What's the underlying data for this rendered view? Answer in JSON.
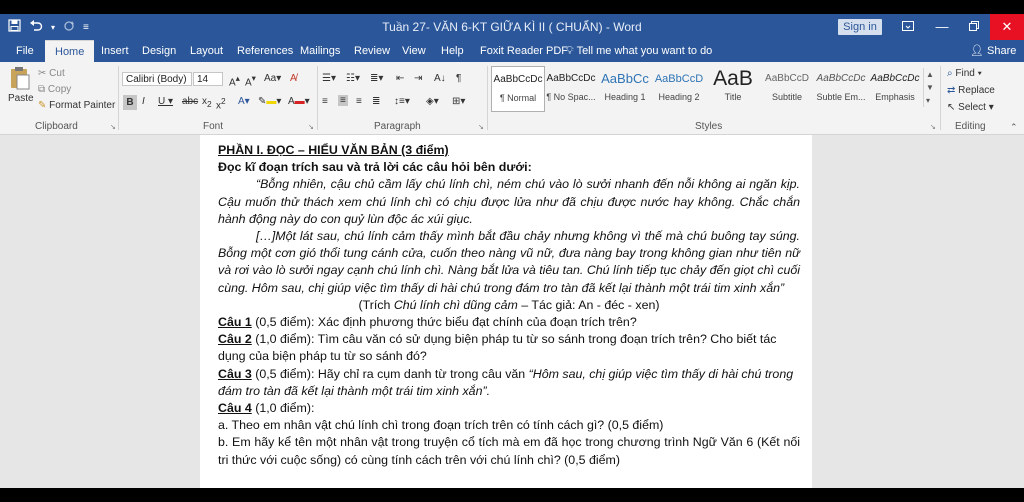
{
  "window": {
    "title": "Tuần 27- VĂN 6-KT GIỮA KÌ II ( CHUẨN) - Word",
    "sign_in": "Sign in",
    "icons": [
      "save-icon",
      "undo-icon",
      "redo-icon",
      "customize-qat-icon",
      "ribbon-display-icon",
      "minimize-icon",
      "restore-icon",
      "close-icon"
    ]
  },
  "tabs": [
    "File",
    "Home",
    "Insert",
    "Design",
    "Layout",
    "References",
    "Mailings",
    "Review",
    "View",
    "Help",
    "Foxit Reader PDF"
  ],
  "active_tab": "Home",
  "tell_me": "Tell me what you want to do",
  "share": "Share",
  "ribbon": {
    "clipboard": {
      "paste": "Paste",
      "cut": "Cut",
      "copy": "Copy",
      "format_painter": "Format Painter",
      "label": "Clipboard"
    },
    "font": {
      "name": "Calibri (Body)",
      "size": "14",
      "label": "Font"
    },
    "paragraph": {
      "label": "Paragraph"
    },
    "styles": {
      "label": "Styles",
      "items": [
        {
          "preview": "AaBbCcDc",
          "name": "¶ Normal"
        },
        {
          "preview": "AaBbCcDc",
          "name": "¶ No Spac..."
        },
        {
          "preview": "AaBbCc",
          "name": "Heading 1"
        },
        {
          "preview": "AaBbCcD",
          "name": "Heading 2"
        },
        {
          "preview": "AaB",
          "name": "Title"
        },
        {
          "preview": "AaBbCcD",
          "name": "Subtitle"
        },
        {
          "preview": "AaBbCcDc",
          "name": "Subtle Em..."
        },
        {
          "preview": "AaBbCcDc",
          "name": "Emphasis"
        }
      ]
    },
    "editing": {
      "find": "Find",
      "replace": "Replace",
      "select": "Select",
      "label": "Editing"
    }
  },
  "document": {
    "heading": "PHẦN I. ĐỌC – HIỂU VĂN BẢN (3 điểm)",
    "instruction": "Đọc kĩ đoạn trích sau và trả lời các câu hỏi bên dưới:",
    "passage_1": "“Bỗng nhiên, cậu chủ cầm lấy chú lính chì, ném chú vào lò sưởi nhanh đến nỗi không ai ngăn kịp. Cậu muốn thử thách xem chú lính chì có chịu được lửa như đã chịu được nước hay không. Chắc chắn hành động này do con quỷ lùn độc ác xúi giục.",
    "passage_2": "[…]Một lát sau, chú lính cảm thấy mình bắt đầu chảy nhưng không vì thế mà chú buông tay súng. Bỗng một cơn gió thổi tung cánh cửa, cuốn theo nàng vũ nữ, đưa nàng bay trong không gian như tiên nữ và rơi vào lò sưởi ngay cạnh chú lính chì. Nàng bắt lửa và tiêu tan. Chú lính tiếp tục chảy đến giọt chì cuối cùng. Hôm sau, chị giúp việc tìm thấy di hài chú trong đám tro tàn đã kết lại thành một trái tim xinh xắn”",
    "source_prefix": "(Trích ",
    "source_title": "Chú lính chì dũng cảm",
    "source_suffix": " – Tác giả: An - đéc - xen)",
    "q1_label": "Câu 1",
    "q1_text": " (0,5 điểm): Xác định phương thức biểu đạt chính của đoạn trích trên?",
    "q2_label": "Câu 2",
    "q2_text": " (1,0 điểm): Tìm câu văn có sử dụng biện pháp tu từ so sánh trong đoạn trích trên? Cho biết tác dụng của biện pháp tu từ so sánh đó?",
    "q3_label": "Câu 3",
    "q3_text": " (0,5 điểm): Hãy chỉ ra cụm danh từ trong câu văn ",
    "q3_quote": "“Hôm sau, chị giúp việc tìm thấy di hài chú trong đám tro tàn đã kết lại thành một trái tim xinh xắn”.",
    "q4_label": "Câu 4",
    "q4_text": " (1,0 điểm):",
    "q4a": "a. Theo em nhân vật chú lính chì trong đoạn trích trên có tính cách gì?  (0,5 điểm)",
    "q4b": "b. Em hãy kể tên một nhân vật trong truyện cổ tích mà em đã học trong chương trình Ngữ Văn 6 (Kết nối tri thức với cuộc sống) có cùng tính cách trên với chú lính chì? (0,5 điểm)"
  }
}
